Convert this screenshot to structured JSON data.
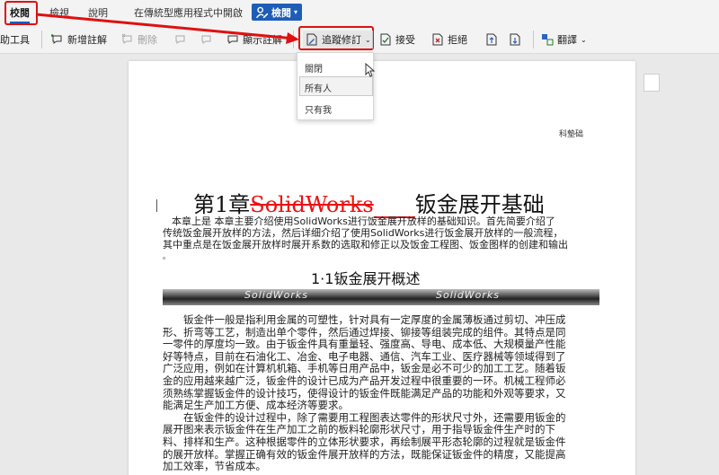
{
  "tabs": {
    "review": "校閱",
    "view": "檢視",
    "help": "說明",
    "open_desktop": "在傳統型應用程式中開啟",
    "check_button": "檢閱"
  },
  "ribbon": {
    "aux_tool": "助工具",
    "new_comment": "新增註解",
    "delete": "刪除",
    "show_comments": "顯示註解",
    "track_changes": "追蹤修訂",
    "accept": "接受",
    "reject": "拒絕",
    "translate": "翻譯"
  },
  "dropdown": {
    "items": [
      "關閉",
      "所有人",
      "只有我"
    ]
  },
  "document": {
    "header_right": "科墊础",
    "title_prefix": "第1章",
    "title_strike": "SolidWorks",
    "title_suffix": "钣金展开基础",
    "intro_line1": "本章上是 本章主要介绍使用SolidWorks进行饭金展开放样的基础知识。首先简要介绍了",
    "intro_line2": "传统饭金展开放样的方法，然后详细介绍了使用SolidWorks进行饭金展开放样的一般流程，",
    "intro_line3": "其中重点是在饭金展开放样时展开系数的选取和修正以及饭金工程图、饭金图样的创建和输出",
    "intro_line4": "。",
    "section_title": "1·1钣金展开概述",
    "img_text_left": "SolidWorks",
    "img_text_right": "SolidWorks",
    "body_lines": [
      "钣金件一般是指利用金属的可塑性，针对具有一定厚度的金属薄板通过剪切、冲压成",
      "形、折弯等工艺，制造出单个零件，然后通过焊接、铆接等组装完成的组件。其特点是同",
      "一零件的厚度均一致。由于钣金件具有重量轻、强度高、导电、成本低、大规模量产性能",
      "好等特点，目前在石油化工、冶金、电子电器、通信、汽车工业、医疗器械等领域得到了",
      "广泛应用，例如在计算机机箱、手机等日用产品中，钣金是必不可少的加工工艺。随着钣",
      "金的应用越来越广泛，钣金件的设计已成为产品开发过程中很重要的一环。机械工程师必",
      "须熟练掌握钣金件的设计技巧，使得设计的钣金件既能满足产品的功能和外观等要求，又",
      "能满足生产加工方便、成本经济等要求。",
      "在钣金件的设计过程中，除了需要用工程图表达零件的形状尺寸外，还需要用钣金的",
      "展开图来表示钣金件在生产加工之前的板料轮廓形状尺寸，用于指导钣金件生产时的下",
      "料、排样和生产。这种根据零件的立体形状要求，再绘制展平形态轮廓的过程就是钣金件",
      "的展开放样。掌握正确有效的钣金件展开放样的方法，既能保证钣金件的精度，又能提高",
      "加工效率，节省成本。"
    ]
  },
  "colors": {
    "accent": "#1e5cb8",
    "highlight_red": "#e01010"
  }
}
